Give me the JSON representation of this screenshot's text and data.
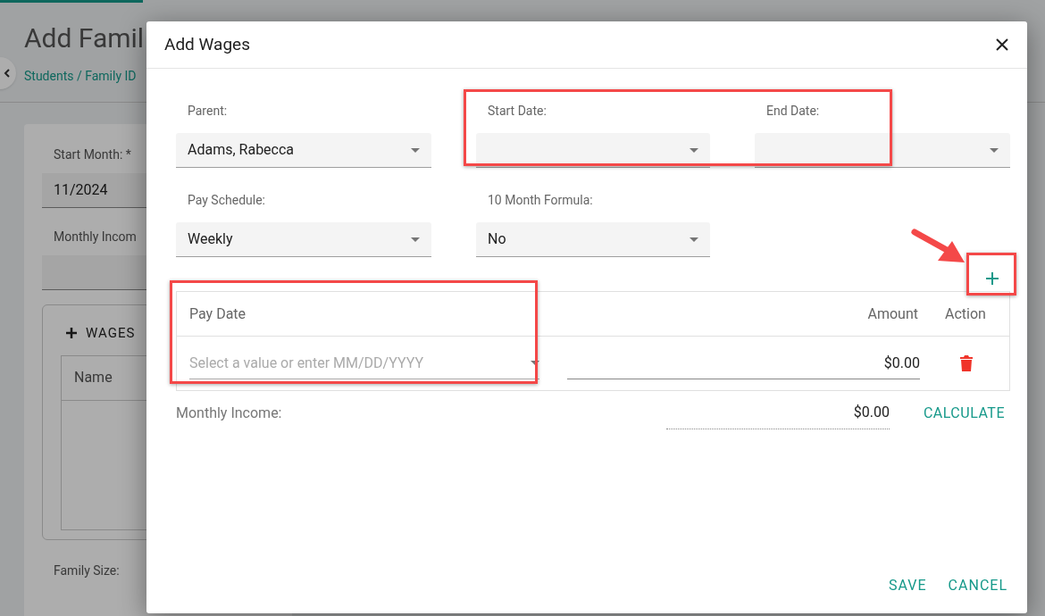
{
  "background_page": {
    "title": "Add Famil",
    "breadcrumb": "Students / Family ID",
    "fields": [
      {
        "label": "Start Month: *",
        "value": "11/2024"
      },
      {
        "label": "Monthly Incom"
      }
    ],
    "wages_panel": {
      "button": "WAGES",
      "columns": [
        "Name"
      ]
    },
    "family_size_label": "Family Size:"
  },
  "dialog": {
    "title": "Add Wages",
    "fields": [
      {
        "label": "Parent:",
        "value": "Adams, Rabecca"
      },
      {
        "label": "Start Date:"
      },
      {
        "label": "End Date:"
      },
      {
        "label": "Pay Schedule:",
        "value": "Weekly"
      },
      {
        "label": "10 Month Formula:",
        "value": "No"
      }
    ],
    "table": {
      "columns": [
        "Pay Date",
        "Amount",
        "Action"
      ],
      "rows": [
        {
          "pay_date_placeholder": "Select a value or enter MM/DD/YYYY",
          "amount": "$0.00"
        }
      ]
    },
    "monthly_income": {
      "label": "Monthly Income:",
      "value": "$0.00"
    },
    "calculate_button": "CALCULATE",
    "footer_buttons": [
      "SAVE",
      "CANCEL"
    ]
  }
}
